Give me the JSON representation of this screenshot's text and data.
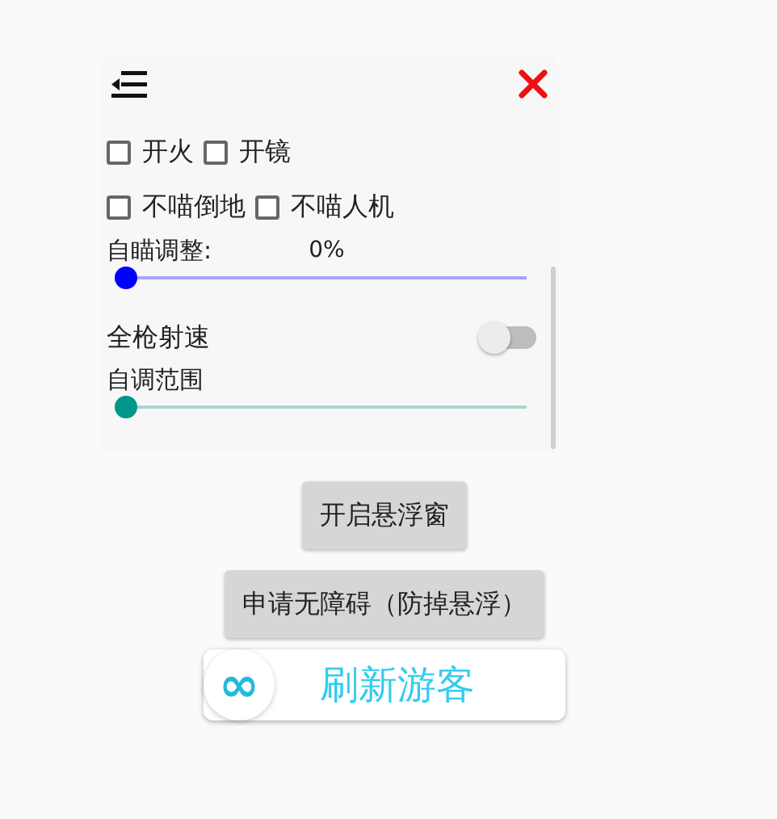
{
  "panel": {
    "controls": [
      {
        "kind": "checkboxes",
        "items": [
          {
            "label": "开火",
            "checked": false
          },
          {
            "label": "开镜",
            "checked": false
          }
        ]
      },
      {
        "kind": "checkboxes",
        "items": [
          {
            "label": "不喵倒地",
            "checked": false
          },
          {
            "label": "不喵人机",
            "checked": false
          }
        ]
      },
      {
        "kind": "slider",
        "label": "自瞄调整:",
        "reading": "0%",
        "level": 0,
        "color": "#0000ff"
      },
      {
        "kind": "switch",
        "label": "全枪射速",
        "on": false
      },
      {
        "kind": "slider",
        "label": "自调范围",
        "level": 0,
        "color": "#009688"
      }
    ]
  },
  "buttons": [
    "开启悬浮窗",
    "申请无障碍（防掉悬浮）"
  ],
  "refresh": {
    "icon": "∞",
    "label": "刷新游客"
  }
}
